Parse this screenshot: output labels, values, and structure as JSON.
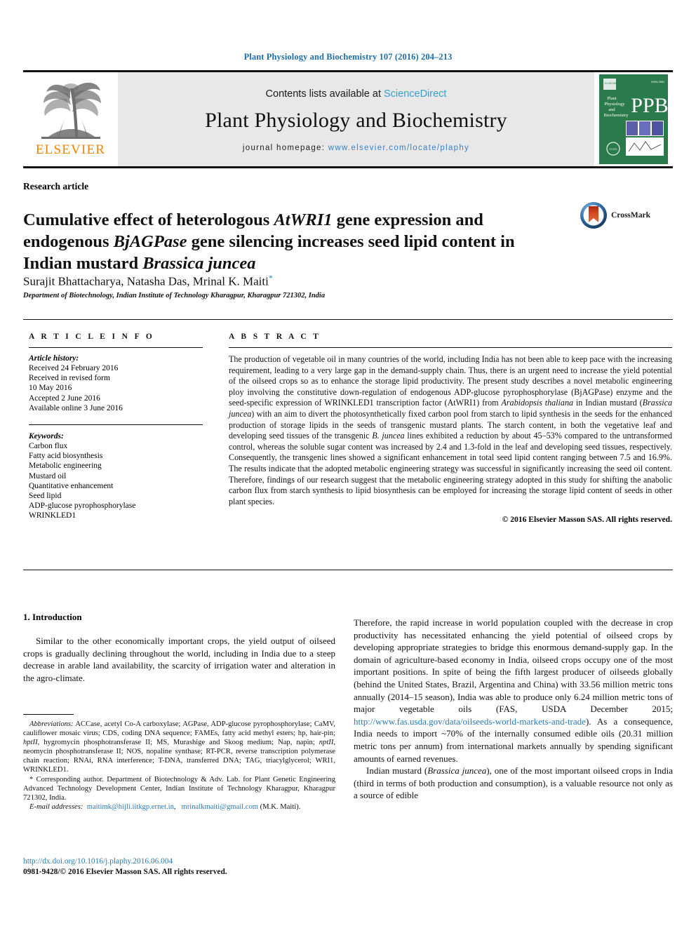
{
  "running_head": "Plant Physiology and Biochemistry 107 (2016) 204–213",
  "masthead": {
    "contents_prefix": "Contents lists available at ",
    "sciencedirect": "ScienceDirect",
    "journal_title": "Plant Physiology and Biochemistry",
    "homepage_prefix": "journal homepage: ",
    "homepage_url": "www.elsevier.com/locate/plaphy",
    "publisher_wordmark": "ELSEVIER",
    "cover_abbrev": "PPB",
    "cover_journal_line1": "Plant",
    "cover_journal_line2": "Physiology",
    "cover_journal_line3": "and",
    "cover_journal_line4": "Biochemistry",
    "link_color": "#3a9ec9",
    "band_color": "#e8e8e8",
    "elsevier_orange": "#ef8200",
    "cover_green": "#2b7a4b"
  },
  "article": {
    "kicker": "Research article",
    "title_line1_a": "Cumulative effect of heterologous ",
    "title_line1_i": "AtWRI1",
    "title_line1_b": " gene expression and",
    "title_line2_a": "endogenous ",
    "title_line2_i": "BjAGPase",
    "title_line2_b": " gene silencing increases seed lipid content in",
    "title_line3_a": "Indian mustard ",
    "title_line3_i": "Brassica juncea",
    "authors": "Surajit Bhattacharya, Natasha Das, Mrinal K. Maiti",
    "corresponding_marker": "*",
    "affiliation": "Department of Biotechnology, Indian Institute of Technology Kharagpur, Kharagpur 721302, India",
    "crossmark_label": "CrossMark"
  },
  "article_info": {
    "heading": "A R T I C L E  I N F O",
    "history_label": "Article history:",
    "history": [
      "Received 24 February 2016",
      "Received in revised form",
      "10 May 2016",
      "Accepted 2 June 2016",
      "Available online 3 June 2016"
    ],
    "keywords_label": "Keywords:",
    "keywords": [
      "Carbon flux",
      "Fatty acid biosynthesis",
      "Metabolic engineering",
      "Mustard oil",
      "Quantitative enhancement",
      "Seed lipid",
      "ADP-glucose pyrophosphorylase",
      "WRINKLED1"
    ]
  },
  "abstract": {
    "heading": "A B S T R A C T",
    "p1_a": "The production of vegetable oil in many countries of the world, including India has not been able to keep pace with the increasing requirement, leading to a very large gap in the demand-supply chain. Thus, there is an urgent need to increase the yield potential of the oilseed crops so as to enhance the storage lipid productivity. The present study describes a novel metabolic engineering ploy involving the constitutive down-regulation of endogenous ADP-glucose pyrophosphorylase (BjAGPase) enzyme and the seed-specific expression of WRINKLED1 transcription factor (AtWRI1) from ",
    "p1_i1": "Arabidopsis thaliana",
    "p1_b": " in Indian mustard (",
    "p1_i2": "Brassica juncea",
    "p1_c": ") with an aim to divert the photosynthetically fixed carbon pool from starch to lipid synthesis in the seeds for the enhanced production of storage lipids in the seeds of transgenic mustard plants. The starch content, in both the vegetative leaf and developing seed tissues of the transgenic ",
    "p1_i3": "B. juncea",
    "p1_d": " lines exhibited a reduction by about 45–53% compared to the untransformed control, whereas the soluble sugar content was increased by 2.4 and 1.3-fold in the leaf and developing seed tissues, respectively. Consequently, the transgenic lines showed a significant enhancement in total seed lipid content ranging between 7.5 and 16.9%. The results indicate that the adopted metabolic engineering strategy was successful in significantly increasing the seed oil content. Therefore, findings of our research suggest that the metabolic engineering strategy adopted in this study for shifting the anabolic carbon flux from starch synthesis to lipid biosynthesis can be employed for increasing the storage lipid content of seeds in other plant species.",
    "copyright": "© 2016 Elsevier Masson SAS. All rights reserved."
  },
  "introduction": {
    "heading": "1. Introduction",
    "left_p1": "Similar to the other economically important crops, the yield output of oilseed crops is gradually declining throughout the world, including in India due to a steep decrease in arable land availability, the scarcity of irrigation water and alteration in the agro-climate.",
    "right_p1": "Therefore, the rapid increase in world population coupled with the decrease in crop productivity has necessitated enhancing the yield potential of oilseed crops by developing appropriate strategies to bridge this enormous demand-supply gap. In the domain of agriculture-based economy in India, oilseed crops occupy one of the most important positions. In spite of being the fifth largest producer of oilseeds globally (behind the United States, Brazil, Argentina and China) with 33.56 million metric tons annually (2014–15 season), India was able to produce only 6.24 million metric tons of major vegetable oils (FAS, USDA December 2015; ",
    "right_p1_link": "http://www.fas.usda.gov/data/oilseeds-world-markets-and-trade",
    "right_p1_end": "). As a consequence, India needs to import ~70% of the internally consumed edible oils (20.31 million metric tons per annum) from international markets annually by spending significant amounts of earned revenues.",
    "right_p2_a": "Indian mustard (",
    "right_p2_i": "Brassica juncea",
    "right_p2_b": "), one of the most important oilseed crops in India (third in terms of both production and consumption), is a valuable resource not only as a source of edible"
  },
  "footnotes": {
    "abbrev_label": "Abbreviations:",
    "abbrev_a": " ACCase, acetyl Co-A carboxylase; AGPase, ADP-glucose pyrophosphorylase; CaMV, cauliflower mosaic virus; CDS, coding DNA sequence; FAMEs, fatty acid methyl esters; hp, hair-pin; ",
    "abbrev_i1": "hptII",
    "abbrev_b": ", hygromycin phosphotransferase II; MS, Murashige and Skoog medium; Nap, napin; ",
    "abbrev_i2": "nptII",
    "abbrev_c": ", neomycin phosphotransferase II; NOS, nopaline synthase; RT-PCR, reverse transcription polymerase chain reaction; RNAi, RNA interference; T-DNA, transferred DNA; TAG, triacylglycerol; WRI1, WRINKLED1.",
    "corresponding": "* Corresponding author. Department of Biotechnology & Adv. Lab. for Plant Genetic Engineering Advanced Technology Development Center, Indian Institute of Technology Kharagpur, Kharagpur 721302, India.",
    "email_label": "E-mail addresses:",
    "email1": "maitimk@hijli.iitkgp.ernet.in",
    "email_sep": ", ",
    "email2": "mrinalkmaiti@gmail.com",
    "email_owner": "(M.K. Maiti)."
  },
  "footer": {
    "doi": "http://dx.doi.org/10.1016/j.plaphy.2016.06.004",
    "issn": "0981-9428/© 2016 Elsevier Masson SAS. All rights reserved."
  }
}
